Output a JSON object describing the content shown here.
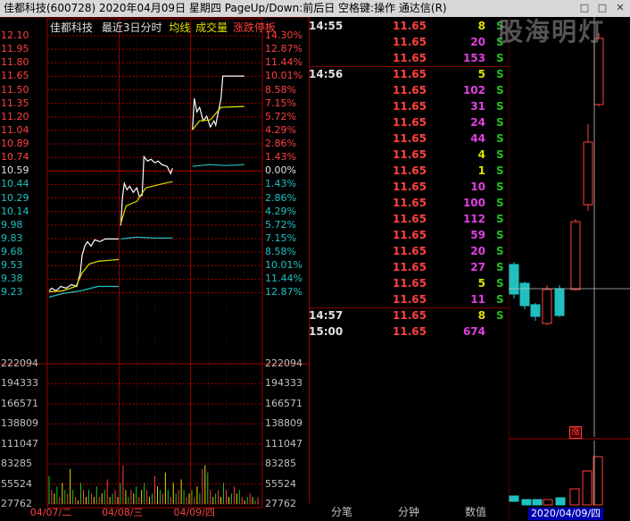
{
  "titlebar": {
    "title": "佳都科技(600728)  2020年04月09日 星期四  PageUp/Down:前后日 空格键:操作 通达信(R)"
  },
  "chart": {
    "name": "佳都科技",
    "mode": "最近3日分时",
    "legend_avg": "均线",
    "legend_vol": "成交量",
    "legend_limit": "涨跌停板",
    "price_labels": [
      "12.10",
      "11.95",
      "11.80",
      "11.65",
      "11.50",
      "11.35",
      "11.20",
      "11.04",
      "10.89",
      "10.74",
      "10.59",
      "10.44",
      "10.29",
      "10.14",
      "9.98",
      "9.83",
      "9.68",
      "9.53",
      "9.38",
      "9.23"
    ],
    "pct_labels": [
      "14.30%",
      "12.87%",
      "11.44%",
      "10.01%",
      "8.58%",
      "7.15%",
      "5.72%",
      "4.29%",
      "2.86%",
      "1.43%",
      "0.00%",
      "1.43%",
      "2.86%",
      "4.29%",
      "5.72%",
      "7.15%",
      "8.58%",
      "10.01%",
      "11.44%",
      "12.87%"
    ],
    "volume_labels": [
      "222094",
      "194333",
      "166571",
      "138809",
      "111047",
      "83285",
      "55524",
      "27762"
    ],
    "date_labels": [
      "04/07/二",
      "04/08/三",
      "04/09/四"
    ],
    "colors": {
      "up": "#ff4040",
      "down": "#20c0c0",
      "grid": "#a00000",
      "price": "#ffffff",
      "avg": "#e0e000"
    }
  },
  "ticks": [
    {
      "time": "14:55",
      "price": "11.65",
      "vol": "8",
      "vol_color": "#e0e000",
      "side": "S"
    },
    {
      "time": "",
      "price": "11.65",
      "vol": "20",
      "vol_color": "#e040e0",
      "side": "S"
    },
    {
      "time": "",
      "price": "11.65",
      "vol": "153",
      "vol_color": "#e040e0",
      "side": "S"
    },
    {
      "time": "14:56",
      "price": "11.65",
      "vol": "5",
      "vol_color": "#e0e000",
      "side": "S"
    },
    {
      "time": "",
      "price": "11.65",
      "vol": "102",
      "vol_color": "#e040e0",
      "side": "S"
    },
    {
      "time": "",
      "price": "11.65",
      "vol": "31",
      "vol_color": "#e040e0",
      "side": "S"
    },
    {
      "time": "",
      "price": "11.65",
      "vol": "24",
      "vol_color": "#e040e0",
      "side": "S"
    },
    {
      "time": "",
      "price": "11.65",
      "vol": "44",
      "vol_color": "#e040e0",
      "side": "S"
    },
    {
      "time": "",
      "price": "11.65",
      "vol": "4",
      "vol_color": "#e0e000",
      "side": "S"
    },
    {
      "time": "",
      "price": "11.65",
      "vol": "1",
      "vol_color": "#e0e000",
      "side": "S"
    },
    {
      "time": "",
      "price": "11.65",
      "vol": "10",
      "vol_color": "#e040e0",
      "side": "S"
    },
    {
      "time": "",
      "price": "11.65",
      "vol": "100",
      "vol_color": "#e040e0",
      "side": "S"
    },
    {
      "time": "",
      "price": "11.65",
      "vol": "112",
      "vol_color": "#e040e0",
      "side": "S"
    },
    {
      "time": "",
      "price": "11.65",
      "vol": "59",
      "vol_color": "#e040e0",
      "side": "S"
    },
    {
      "time": "",
      "price": "11.65",
      "vol": "20",
      "vol_color": "#e040e0",
      "side": "S"
    },
    {
      "time": "",
      "price": "11.65",
      "vol": "27",
      "vol_color": "#e040e0",
      "side": "S"
    },
    {
      "time": "",
      "price": "11.65",
      "vol": "5",
      "vol_color": "#e0e000",
      "side": "S"
    },
    {
      "time": "",
      "price": "11.65",
      "vol": "11",
      "vol_color": "#e040e0",
      "side": "S"
    },
    {
      "time": "14:57",
      "price": "11.65",
      "vol": "8",
      "vol_color": "#e0e000",
      "side": "S"
    },
    {
      "time": "15:00",
      "price": "11.65",
      "vol": "674",
      "vol_color": "#e040e0",
      "side": ""
    }
  ],
  "tabs": {
    "tab1": "分笔",
    "tab2": "分钟",
    "tab3": "数值"
  },
  "kline": {
    "date_label": "2020/04/09/四",
    "limit_mark": "涨"
  },
  "watermark": "股海明灯"
}
